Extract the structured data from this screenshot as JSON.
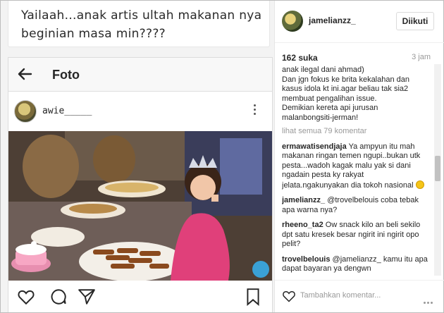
{
  "caption": {
    "line1": "Yailaah...anak artis ultah makanan nya",
    "line2": "beginian masa min????"
  },
  "app": {
    "title": "Foto",
    "post_username": "awie_____"
  },
  "panel": {
    "username": "jamelianzz_",
    "follow_label": "Diikuti",
    "likes": "162 suka",
    "time": "3 jam",
    "add_comment_placeholder": "Tambahkan komentar..."
  },
  "comments": {
    "truncated_body": [
      "anak ilegal dani ahmad)",
      "Dan jgn fokus ke brita kekalahan dan",
      "kasus idola kt ini.agar beliau tak sia2",
      "membuat pengalihan issue.",
      "Demikian kereta api jurusan",
      "malanbongsiti-jerman!"
    ],
    "view_all": "lihat semua 79 komentar",
    "items": [
      {
        "user": "ermawatisendjaja",
        "text": " Ya ampyun itu mah makanan ringan temen ngupi..bukan utk pesta...wadoh kagak malu yak si dani ngadain pesta ky rakyat jelata.ngakunyakan dia tokoh nasional ",
        "emoji": "grinning-face-emoji"
      },
      {
        "user": "jamelianzz_",
        "text": " @trovelbelouis coba tebak apa warna nya?"
      },
      {
        "user": "rheeno_ta2",
        "text": " Ow snack kilo an beli sekilo dpt satu kresek besar ngirit ini ngirit opo pelit?"
      },
      {
        "user": "trovelbelouis",
        "text": " @jamelianzz_ kamu itu apa dapat bayaran ya dengwn"
      }
    ]
  },
  "icons": {
    "back": "back-arrow-icon",
    "more": "more-options-icon",
    "like": "heart-icon",
    "comment": "comment-icon",
    "share": "send-icon",
    "save": "bookmark-icon"
  },
  "colors": {
    "text": "#262626",
    "muted": "#999999",
    "link": "#003569",
    "border": "#dbdbdb"
  }
}
